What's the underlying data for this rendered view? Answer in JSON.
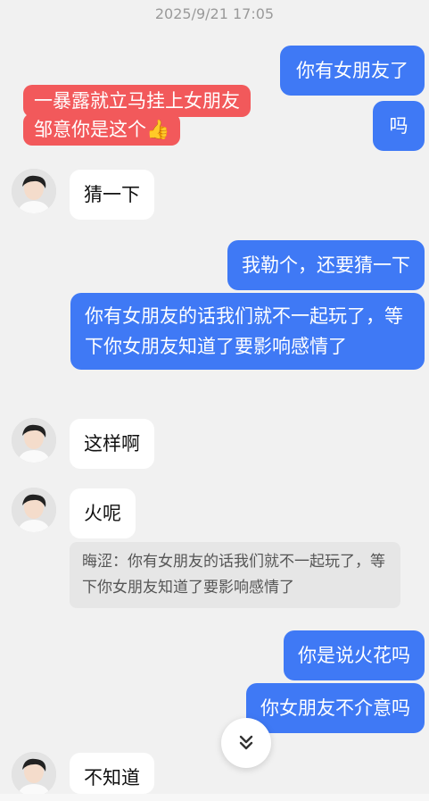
{
  "timestamp": "2025/9/21 17:05",
  "messages": [
    {
      "id": "m1",
      "side": "out",
      "text": "你有女朋友了"
    },
    {
      "id": "m2",
      "side": "out",
      "text": "吗"
    },
    {
      "id": "m3",
      "side": "in",
      "text": "猜一下"
    },
    {
      "id": "m4",
      "side": "out",
      "text": "我勒个，还要猜一下"
    },
    {
      "id": "m5",
      "side": "out",
      "text": "你有女朋友的话我们就不一起玩了，等下你女朋友知道了要影响感情了"
    },
    {
      "id": "m6",
      "side": "in",
      "text": "这样啊"
    },
    {
      "id": "m7",
      "side": "in",
      "text": "火呢"
    },
    {
      "id": "m8",
      "side": "out",
      "text": "你是说火花吗"
    },
    {
      "id": "m9",
      "side": "out",
      "text": "你女朋友不介意吗"
    },
    {
      "id": "m10",
      "side": "in",
      "text": "不知道"
    }
  ],
  "quote": {
    "text": "晦涩：你有女朋友的话我们就不一起玩了，等下你女朋友知道了要影响感情了"
  },
  "overlay": {
    "line1": "一暴露就立马挂上女朋友",
    "line2": "邹意你是这个👍"
  },
  "colors": {
    "outgoing": "#3f79f5",
    "incoming": "#ffffff",
    "overlay": "#f2595b",
    "background": "#f1f1f1"
  },
  "icons": {
    "scroll": "chevron-double-down-icon",
    "avatar": "contact-avatar"
  }
}
